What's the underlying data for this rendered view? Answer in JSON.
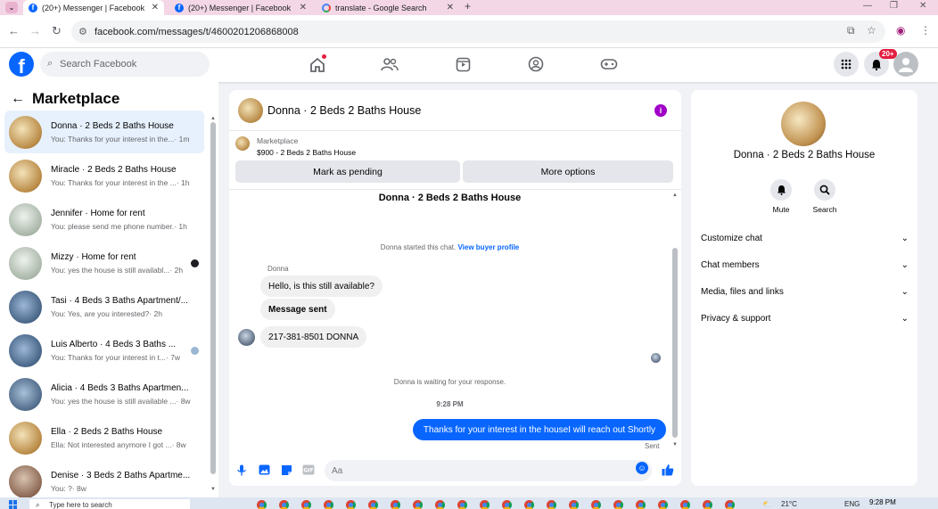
{
  "browser": {
    "tabs": [
      {
        "title": "(20+) Messenger | Facebook",
        "icon": "facebook-icon",
        "active": true
      },
      {
        "title": "(20+) Messenger | Facebook",
        "icon": "facebook-icon",
        "active": false
      },
      {
        "title": "translate - Google Search",
        "icon": "google-icon",
        "active": false
      }
    ],
    "url": "facebook.com/messages/t/4600201206868008"
  },
  "header": {
    "search_placeholder": "Search Facebook",
    "notification_badge": "20+"
  },
  "sidebar": {
    "title": "Marketplace",
    "conversations": [
      {
        "name": "Donna · 2 Beds 2 Baths House",
        "snippet": "You: Thanks for your interest in the...",
        "time": "· 1m",
        "selected": true,
        "status": "none"
      },
      {
        "name": "Miracle · 2 Beds 2 Baths House",
        "snippet": "You: Thanks for your interest in the ...",
        "time": "· 1h",
        "selected": false,
        "status": "none"
      },
      {
        "name": "Jennifer · Home for rent",
        "snippet": "You: please send me phone number.",
        "time": "· 1h",
        "selected": false,
        "status": "none"
      },
      {
        "name": "Mizzy · Home for rent",
        "snippet": "You: yes the house is still availabl...",
        "time": "· 2h",
        "selected": false,
        "status": "unread"
      },
      {
        "name": "Tasi · 4 Beds 3 Baths Apartment/...",
        "snippet": "You: Yes, are you interested?",
        "time": "· 2h",
        "selected": false,
        "status": "none"
      },
      {
        "name": "Luis Alberto · 4 Beds 3 Baths ...",
        "snippet": "You: Thanks for your interest in t...",
        "time": "· 7w",
        "selected": false,
        "status": "read"
      },
      {
        "name": "Alicia · 4 Beds 3 Baths Apartmen...",
        "snippet": "You: yes the house is still available ...",
        "time": "· 8w",
        "selected": false,
        "status": "none"
      },
      {
        "name": "Ella · 2 Beds 2 Baths House",
        "snippet": "Ella: Not interested anymore I got ...",
        "time": "· 8w",
        "selected": false,
        "status": "none"
      },
      {
        "name": "Denise · 3 Beds 2 Baths Apartme...",
        "snippet": "You: ?",
        "time": "· 8w",
        "selected": false,
        "status": "none"
      }
    ]
  },
  "chat": {
    "title": "Donna · 2 Beds 2 Baths House",
    "listing_label": "Marketplace",
    "listing_price": "$900 - 2 Beds 2 Baths House",
    "pending_button": "Mark as pending",
    "more_options_button": "More options",
    "thread_title": "Donna · 2 Beds 2 Baths House",
    "started_text": "Donna started this chat.",
    "view_profile_link": "View buyer profile",
    "sender_name": "Donna",
    "messages_in": [
      "Hello, is this still available?",
      "Message sent",
      "217-381-8501 DONNA"
    ],
    "waiting_text": "Donna is waiting for your response.",
    "time": "9:28 PM",
    "message_out": "Thanks for your interest in the houseI will reach out Shortly",
    "sent_label": "Sent",
    "composer_placeholder": "Aa"
  },
  "details": {
    "name": "Donna · 2 Beds 2 Baths House",
    "mute_label": "Mute",
    "search_label": "Search",
    "sections": [
      "Customize chat",
      "Chat members",
      "Media, files and links",
      "Privacy & support"
    ]
  },
  "taskbar": {
    "search_placeholder": "Type here to search",
    "temperature": "21°C",
    "language": "ENG",
    "clock": "9:28 PM"
  }
}
